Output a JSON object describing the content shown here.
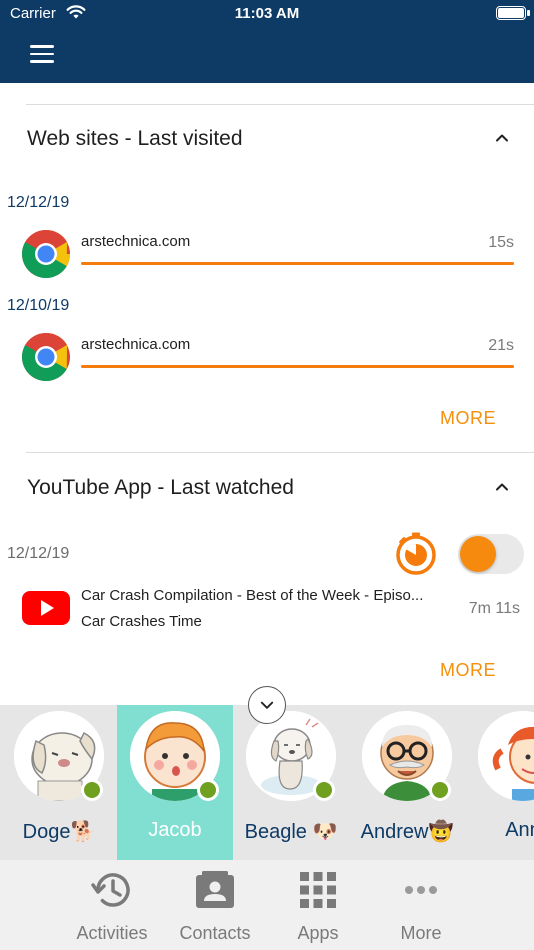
{
  "status_bar": {
    "carrier": "Carrier",
    "time": "11:03 AM"
  },
  "colors": {
    "nav": "#0e3a66",
    "accent": "#f47b0c",
    "selected_contact": "#80dfd1",
    "online": "#6fa020"
  },
  "web_section": {
    "title": "Web sites - Last visited",
    "entries": [
      {
        "date": "12/12/19",
        "site": "arstechnica.com",
        "duration": "15s",
        "progress": 1.0,
        "icon": "chrome-icon"
      },
      {
        "date": "12/10/19",
        "site": "arstechnica.com",
        "duration": "21s",
        "progress": 1.0,
        "icon": "chrome-icon"
      }
    ],
    "more_label": "MORE"
  },
  "youtube_section": {
    "title": "YouTube App - Last watched",
    "date": "12/12/19",
    "toggle_on": true,
    "video": {
      "title": "Car Crash Compilation - Best of the Week - Episo...",
      "channel": "Car Crashes Time",
      "duration": "7m 11s",
      "icon": "youtube-icon"
    },
    "more_label": "MORE"
  },
  "contacts": [
    {
      "name": "Doge🐕",
      "online": true,
      "selected": false
    },
    {
      "name": "Jacob",
      "online": true,
      "selected": true
    },
    {
      "name": "Beagle 🐶",
      "online": true,
      "selected": false
    },
    {
      "name": "Andrew🤠",
      "online": true,
      "selected": false
    },
    {
      "name": "Ann",
      "online": false,
      "selected": false
    }
  ],
  "tabs": [
    {
      "label": "Activities",
      "icon": "history-icon"
    },
    {
      "label": "Contacts",
      "icon": "contact-card-icon"
    },
    {
      "label": "Apps",
      "icon": "apps-grid-icon"
    },
    {
      "label": "More",
      "icon": "more-dots-icon"
    }
  ]
}
